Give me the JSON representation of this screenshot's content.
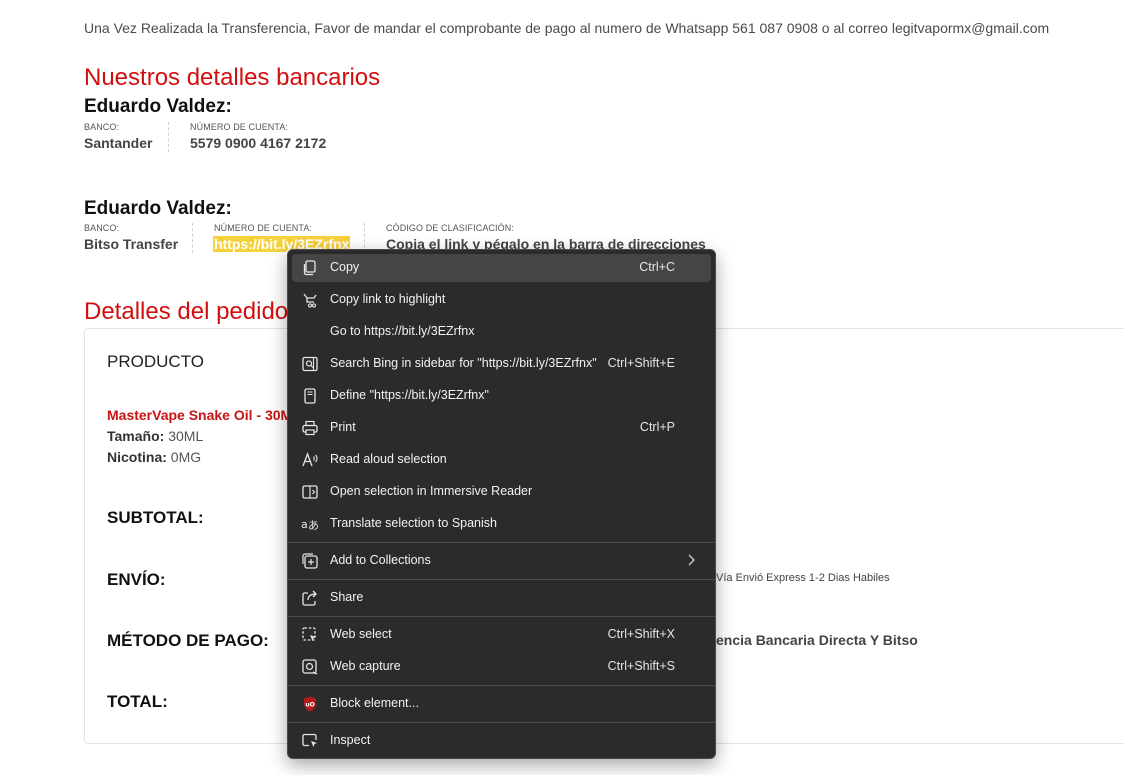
{
  "notice": "Una Vez Realizada la Transferencia, Favor de mandar el comprobante de pago al numero de Whatsapp 561 087 0908 o al correo legitvapormx@gmail.com",
  "bank_section": {
    "title": "Nuestros detalles bancarios",
    "accounts": [
      {
        "holder": "Eduardo Valdez:",
        "bank_label": "BANCO:",
        "bank": "Santander",
        "account_label": "NÚMERO DE CUENTA:",
        "account": "5579 0900 4167 2172"
      },
      {
        "holder": "Eduardo Valdez:",
        "bank_label": "BANCO:",
        "bank": "Bitso Transfer",
        "account_label": "NÚMERO DE CUENTA:",
        "account": "https://bit.ly/3EZrfnx",
        "code_label": "CÓDIGO DE CLASIFICACIÓN:",
        "code": "Copia el link y pégalo en la barra de direcciones"
      }
    ]
  },
  "order": {
    "title": "Detalles del pedido",
    "header": "PRODUCTO",
    "product_name": "MasterVape Snake Oil - 30M",
    "size_label": "Tamaño:",
    "size": "30ML",
    "nicotine_label": "Nicotina:",
    "nicotine": "0MG",
    "subtotal_label": "SUBTOTAL:",
    "shipping_label": "ENVÍO:",
    "shipping_value": "Vía Envió Express 1-2 Dias Habiles",
    "payment_label": "MÉTODO DE PAGO:",
    "payment_value": "encia Bancaria Directa Y Bitso",
    "total_label": "TOTAL:"
  },
  "context_menu": {
    "items": [
      {
        "label": "Copy",
        "shortcut": "Ctrl+C",
        "icon": "copy-icon"
      },
      {
        "label": "Copy link to highlight",
        "shortcut": "",
        "icon": "link-highlight-icon"
      },
      {
        "label": "Go to https://bit.ly/3EZrfnx",
        "shortcut": "",
        "icon": ""
      },
      {
        "label": "Search Bing in sidebar for \"https://bit.ly/3EZrfnx\"",
        "shortcut": "Ctrl+Shift+E",
        "icon": "sidebar-search-icon"
      },
      {
        "label": "Define \"https://bit.ly/3EZrfnx\"",
        "shortcut": "",
        "icon": "book-icon"
      },
      {
        "label": "Print",
        "shortcut": "Ctrl+P",
        "icon": "printer-icon"
      },
      {
        "label": "Read aloud selection",
        "shortcut": "",
        "icon": "read-aloud-icon"
      },
      {
        "label": "Open selection in Immersive Reader",
        "shortcut": "",
        "icon": "immersive-reader-icon"
      },
      {
        "label": "Translate selection to Spanish",
        "shortcut": "",
        "icon": "translate-icon"
      },
      {
        "label": "Add to Collections",
        "shortcut": "",
        "icon": "collections-icon"
      },
      {
        "label": "Share",
        "shortcut": "",
        "icon": "share-icon"
      },
      {
        "label": "Web select",
        "shortcut": "Ctrl+Shift+X",
        "icon": "web-select-icon"
      },
      {
        "label": "Web capture",
        "shortcut": "Ctrl+Shift+S",
        "icon": "web-capture-icon"
      },
      {
        "label": "Block element...",
        "shortcut": "",
        "icon": "ublock-icon"
      },
      {
        "label": "Inspect",
        "shortcut": "",
        "icon": "inspect-icon"
      }
    ]
  },
  "colors": {
    "accent_red": "#d20f0f",
    "highlight": "#f5d23c",
    "menu_bg": "#2b2b2b",
    "ublock_red": "#b31b1b"
  }
}
